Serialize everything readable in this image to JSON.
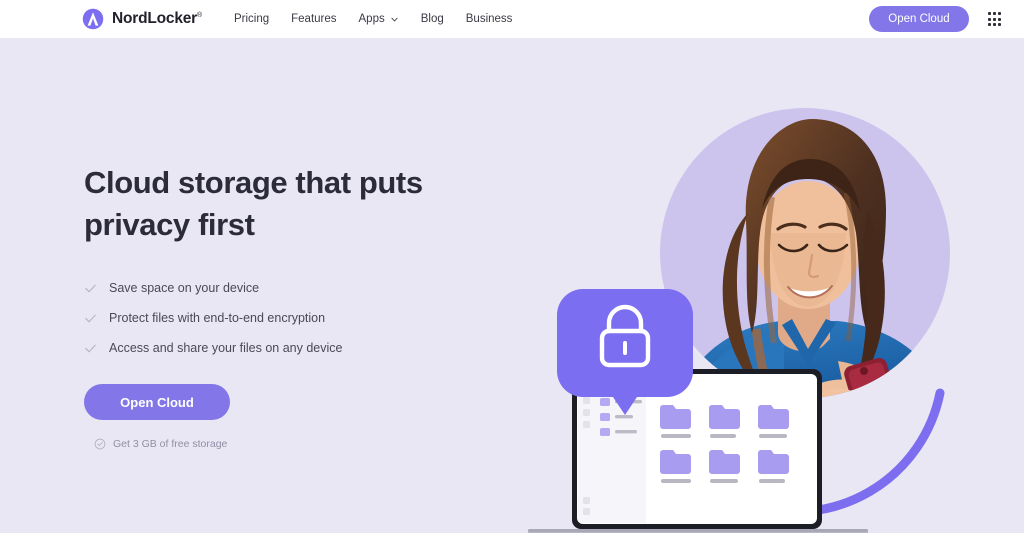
{
  "header": {
    "brand": {
      "name": "NordLocker",
      "registered": "®",
      "logo_icon": "nordlocker-arch-logo"
    },
    "nav": [
      {
        "label": "Pricing",
        "has_dropdown": false
      },
      {
        "label": "Features",
        "has_dropdown": false
      },
      {
        "label": "Apps",
        "has_dropdown": true
      },
      {
        "label": "Blog",
        "has_dropdown": false
      },
      {
        "label": "Business",
        "has_dropdown": false
      }
    ],
    "cta_label": "Open Cloud",
    "app_launcher_icon": "grid-dots-icon"
  },
  "hero": {
    "headline": "Cloud storage that puts\nprivacy first",
    "bullets": [
      "Save space on your device",
      "Protect files with end-to-end encryption",
      "Access and share your files on any device"
    ],
    "cta_label": "Open Cloud",
    "free_note": "Get 3 GB of free storage",
    "free_note_icon": "check-circle-icon",
    "bullet_icon": "check-icon"
  },
  "illustration": {
    "lock_bubble_icon": "padlock-icon",
    "laptop_screen": {
      "folder_count": 6,
      "sidebar_items": 3
    }
  },
  "colors": {
    "accent_purple": "#8276e8",
    "hero_background": "#e9e7f4",
    "header_background": "#ffffff",
    "headline_text": "#2c2b3a",
    "body_text": "#4a4956",
    "muted_text": "#918fa3",
    "circle_lavender": "#cdc4ee",
    "folder_purple": "#a79cf0"
  }
}
